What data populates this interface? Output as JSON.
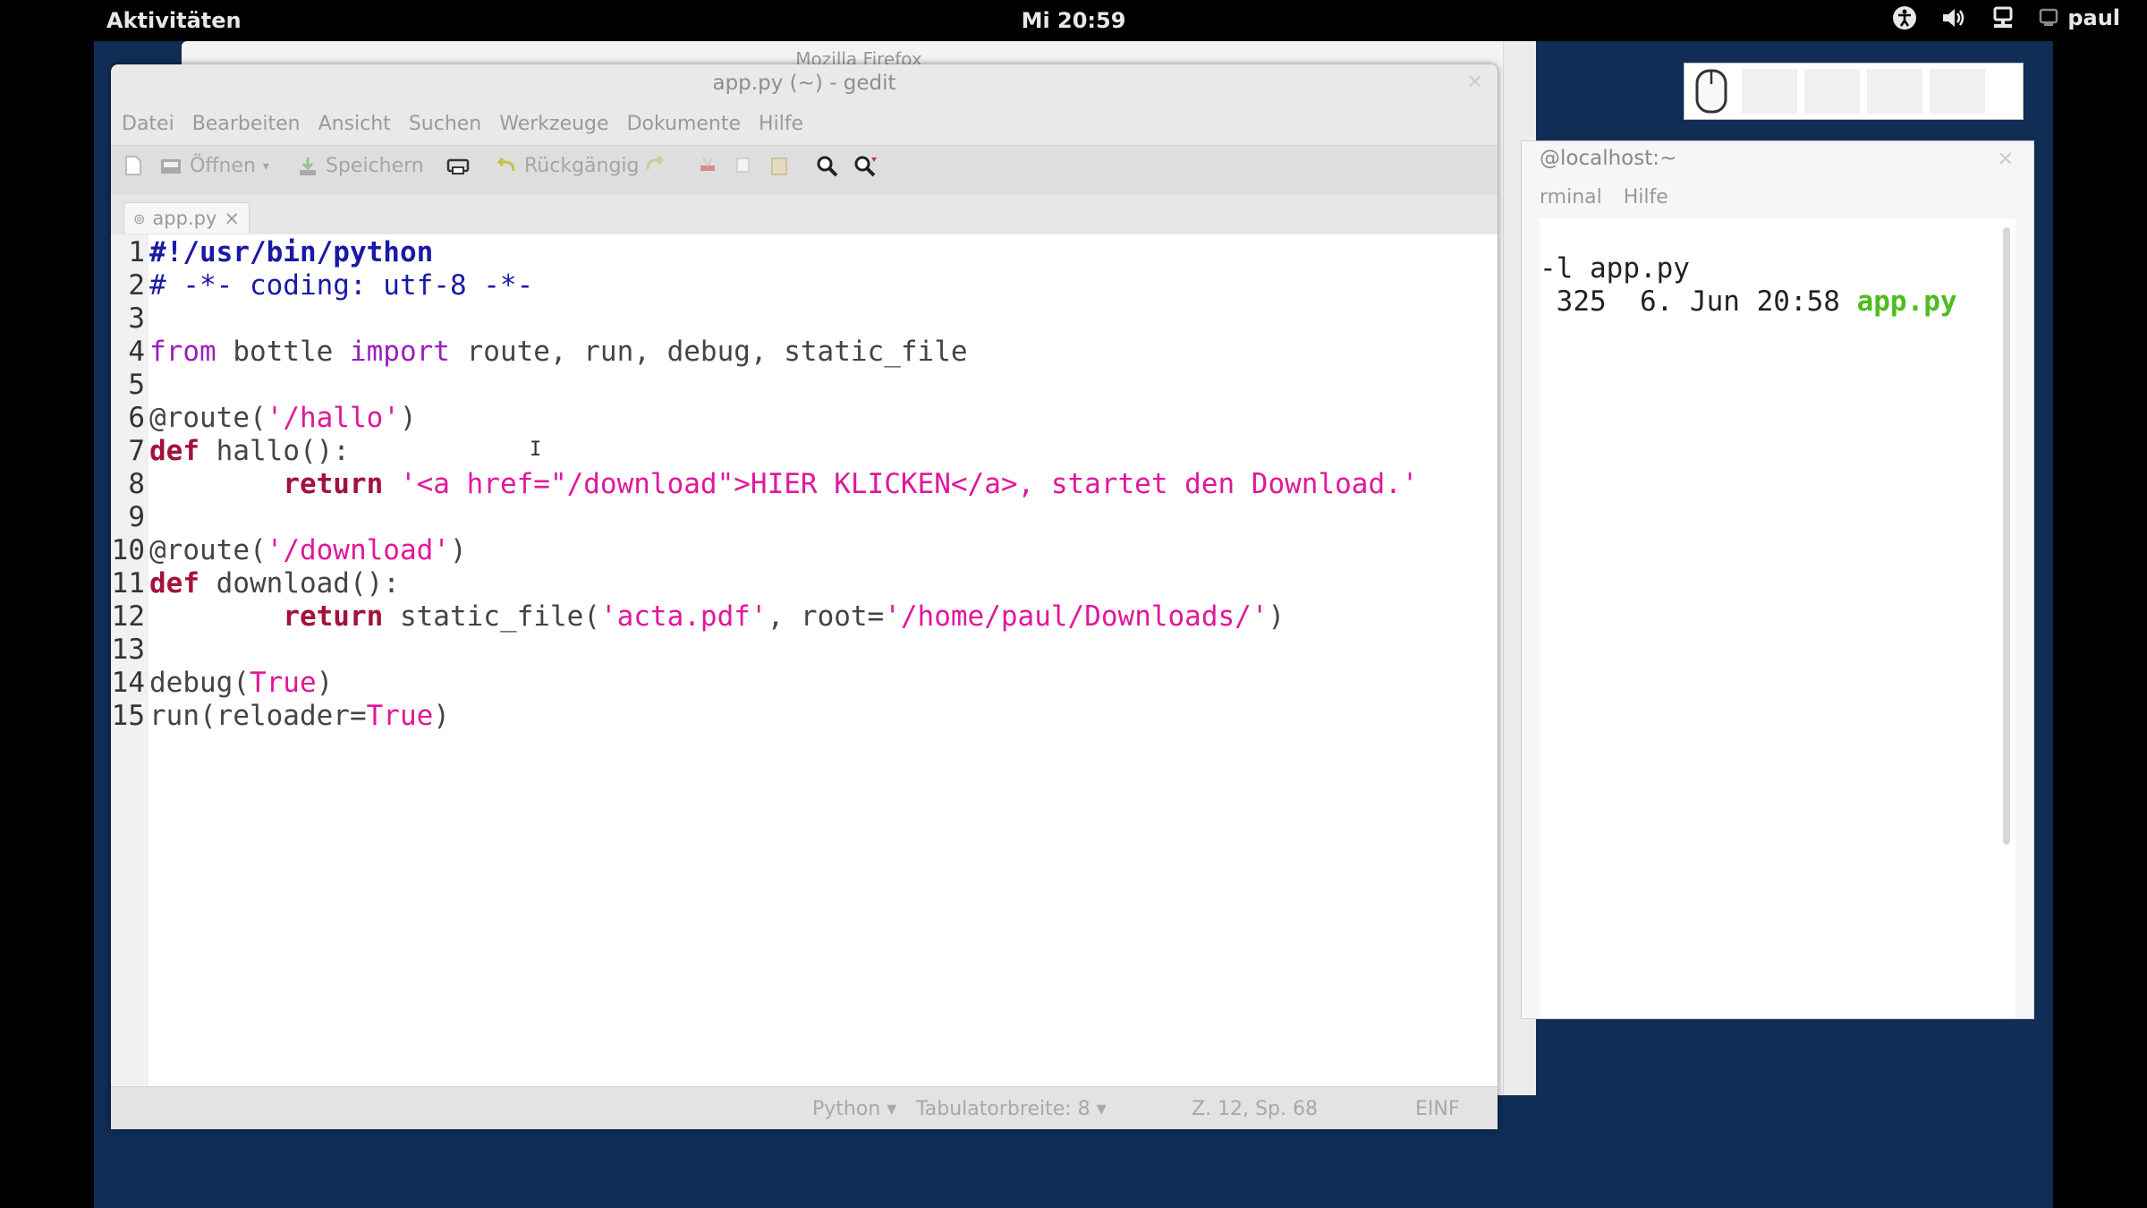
{
  "topbar": {
    "activities": "Aktivitäten",
    "clock": "Mi 20:59",
    "user": "paul",
    "tray_icons": [
      "accessibility-icon",
      "volume-icon",
      "network-icon",
      "user-icon"
    ]
  },
  "firefox": {
    "title": "Mozilla Firefox"
  },
  "terminal": {
    "title": "@localhost:~",
    "menu": [
      "rminal",
      "Hilfe"
    ],
    "lines": [
      {
        "text": "-l app.py"
      },
      {
        "text": " 325  6. Jun 20:58 ",
        "file": "app.py"
      }
    ]
  },
  "overview": {
    "items": [
      "",
      "",
      "",
      ""
    ]
  },
  "gedit": {
    "title": "app.py (~) - gedit",
    "menu": [
      "Datei",
      "Bearbeiten",
      "Ansicht",
      "Suchen",
      "Werkzeuge",
      "Dokumente",
      "Hilfe"
    ],
    "toolbar": {
      "open": "Öffnen",
      "save": "Speichern",
      "undo": "Rückgängig"
    },
    "tab": {
      "label": "app.py",
      "close": "×"
    },
    "code": [
      {
        "n": "1",
        "parts": [
          {
            "t": "#!/usr/bin/python",
            "c": "shebang"
          }
        ]
      },
      {
        "n": "2",
        "parts": [
          {
            "t": "# -*- coding: utf-8 -*-",
            "c": "comment"
          }
        ]
      },
      {
        "n": "3",
        "parts": []
      },
      {
        "n": "4",
        "parts": [
          {
            "t": "from",
            "c": "kw-purple"
          },
          {
            "t": " bottle ",
            "c": "plain"
          },
          {
            "t": "import",
            "c": "kw-purple"
          },
          {
            "t": " route, run, debug, static_file",
            "c": "plain"
          }
        ]
      },
      {
        "n": "5",
        "parts": []
      },
      {
        "n": "6",
        "parts": [
          {
            "t": "@route(",
            "c": "plain"
          },
          {
            "t": "'/hallo'",
            "c": "str"
          },
          {
            "t": ")",
            "c": "plain"
          }
        ]
      },
      {
        "n": "7",
        "parts": [
          {
            "t": "def",
            "c": "kw-red"
          },
          {
            "t": " hallo():",
            "c": "plain"
          }
        ]
      },
      {
        "n": "8",
        "parts": [
          {
            "t": "        ",
            "c": "plain"
          },
          {
            "t": "return",
            "c": "kw-red"
          },
          {
            "t": " ",
            "c": "plain"
          },
          {
            "t": "'<a href=\"/download\">HIER KLICKEN</a>, startet den Download.'",
            "c": "str"
          }
        ]
      },
      {
        "n": "9",
        "parts": []
      },
      {
        "n": "10",
        "parts": [
          {
            "t": "@route(",
            "c": "plain"
          },
          {
            "t": "'/download'",
            "c": "str"
          },
          {
            "t": ")",
            "c": "plain"
          }
        ]
      },
      {
        "n": "11",
        "parts": [
          {
            "t": "def",
            "c": "kw-red"
          },
          {
            "t": " download():",
            "c": "plain"
          }
        ]
      },
      {
        "n": "12",
        "parts": [
          {
            "t": "        ",
            "c": "plain"
          },
          {
            "t": "return",
            "c": "kw-red"
          },
          {
            "t": " static_file(",
            "c": "plain"
          },
          {
            "t": "'acta.pdf'",
            "c": "str"
          },
          {
            "t": ", root=",
            "c": "plain"
          },
          {
            "t": "'/home/paul/Downloads/'",
            "c": "str"
          },
          {
            "t": ")",
            "c": "plain"
          }
        ]
      },
      {
        "n": "13",
        "parts": []
      },
      {
        "n": "14",
        "parts": [
          {
            "t": "debug(",
            "c": "plain"
          },
          {
            "t": "True",
            "c": "builtin"
          },
          {
            "t": ")",
            "c": "plain"
          }
        ]
      },
      {
        "n": "15",
        "parts": [
          {
            "t": "run(reloader=",
            "c": "plain"
          },
          {
            "t": "True",
            "c": "builtin"
          },
          {
            "t": ")",
            "c": "plain"
          }
        ]
      }
    ],
    "status": {
      "language": "Python",
      "tab_width": "Tabulatorbreite: 8",
      "position": "Z. 12, Sp. 68",
      "mode": "EINF"
    }
  }
}
